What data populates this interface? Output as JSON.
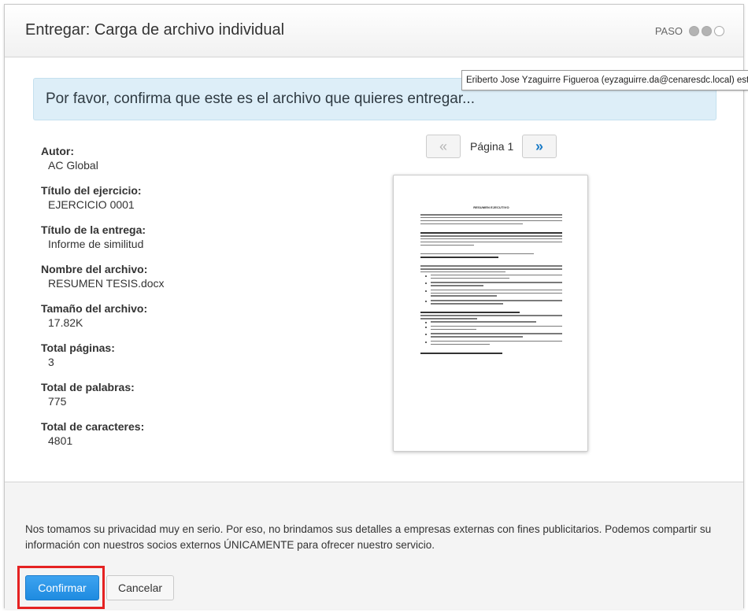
{
  "header": {
    "title": "Entregar: Carga de archivo individual",
    "step_label": "PASO",
    "steps_total": 3,
    "steps_filled": 2
  },
  "tooltip": {
    "text": "Eriberto Jose Yzaguirre Figueroa (eyzaguirre.da@cenaresdc.local) está"
  },
  "alert": {
    "text": "Por favor, confirma que este es el archivo que quieres entregar..."
  },
  "metadata": [
    {
      "label": "Autor:",
      "value": "AC Global"
    },
    {
      "label": "Título del ejercicio:",
      "value": "EJERCICIO 0001"
    },
    {
      "label": "Título de la entrega:",
      "value": "Informe de similitud"
    },
    {
      "label": "Nombre del archivo:",
      "value": "RESUMEN TESIS.docx"
    },
    {
      "label": "Tamaño del archivo:",
      "value": "17.82K"
    },
    {
      "label": "Total páginas:",
      "value": "3"
    },
    {
      "label": "Total de palabras:",
      "value": "775"
    },
    {
      "label": "Total de caracteres:",
      "value": "4801"
    }
  ],
  "pager": {
    "prev": "«",
    "next": "»",
    "label": "Página 1"
  },
  "preview": {
    "doc_title": "RESUMEN EJECUTIVO"
  },
  "footer": {
    "privacy": "Nos tomamos su privacidad muy en serio. Por eso, no brindamos sus detalles a empresas externas con fines publicitarios. Podemos compartir su información con nuestros socios externos ÚNICAMENTE para ofrecer nuestro servicio.",
    "confirm_label": "Confirmar",
    "cancel_label": "Cancelar"
  },
  "colors": {
    "primary": "#1f8be0",
    "alert_bg": "#ddeef8",
    "highlight": "#e52222"
  }
}
